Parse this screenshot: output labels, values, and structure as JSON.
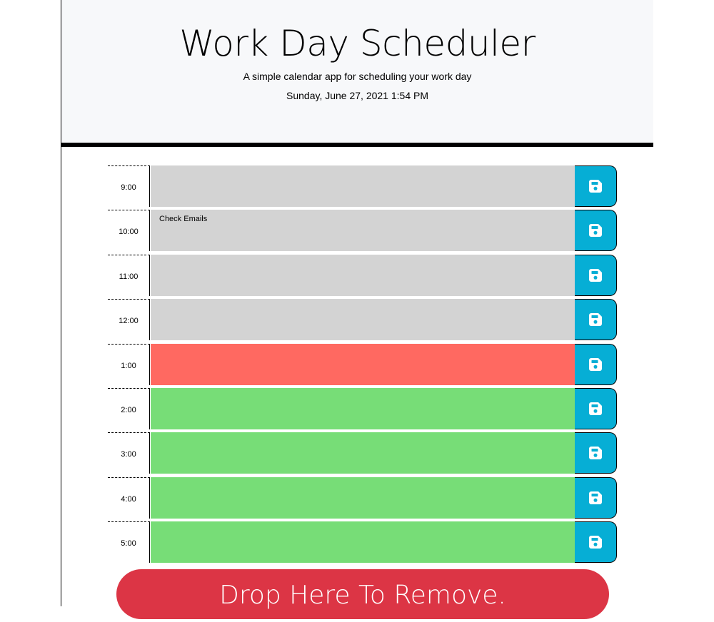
{
  "header": {
    "title": "Work Day Scheduler",
    "subtitle": "A simple calendar app for scheduling your work day",
    "current_day": "Sunday, June 27, 2021 1:54 PM"
  },
  "colors": {
    "past": "#d3d3d3",
    "present": "#ff6961",
    "future": "#77dd77",
    "save_button": "#06aed5",
    "drop_zone": "#dc3545"
  },
  "time_blocks": [
    {
      "hour": "9:00",
      "text": "",
      "status": "past"
    },
    {
      "hour": "10:00",
      "text": "Check Emails",
      "status": "past"
    },
    {
      "hour": "11:00",
      "text": "",
      "status": "past"
    },
    {
      "hour": "12:00",
      "text": "",
      "status": "past"
    },
    {
      "hour": "1:00",
      "text": "",
      "status": "present"
    },
    {
      "hour": "2:00",
      "text": "",
      "status": "future"
    },
    {
      "hour": "3:00",
      "text": "",
      "status": "future"
    },
    {
      "hour": "4:00",
      "text": "",
      "status": "future"
    },
    {
      "hour": "5:00",
      "text": "",
      "status": "future"
    }
  ],
  "save_icon": "floppy-disk-icon",
  "drop_zone": {
    "label": "Drop Here To Remove."
  }
}
